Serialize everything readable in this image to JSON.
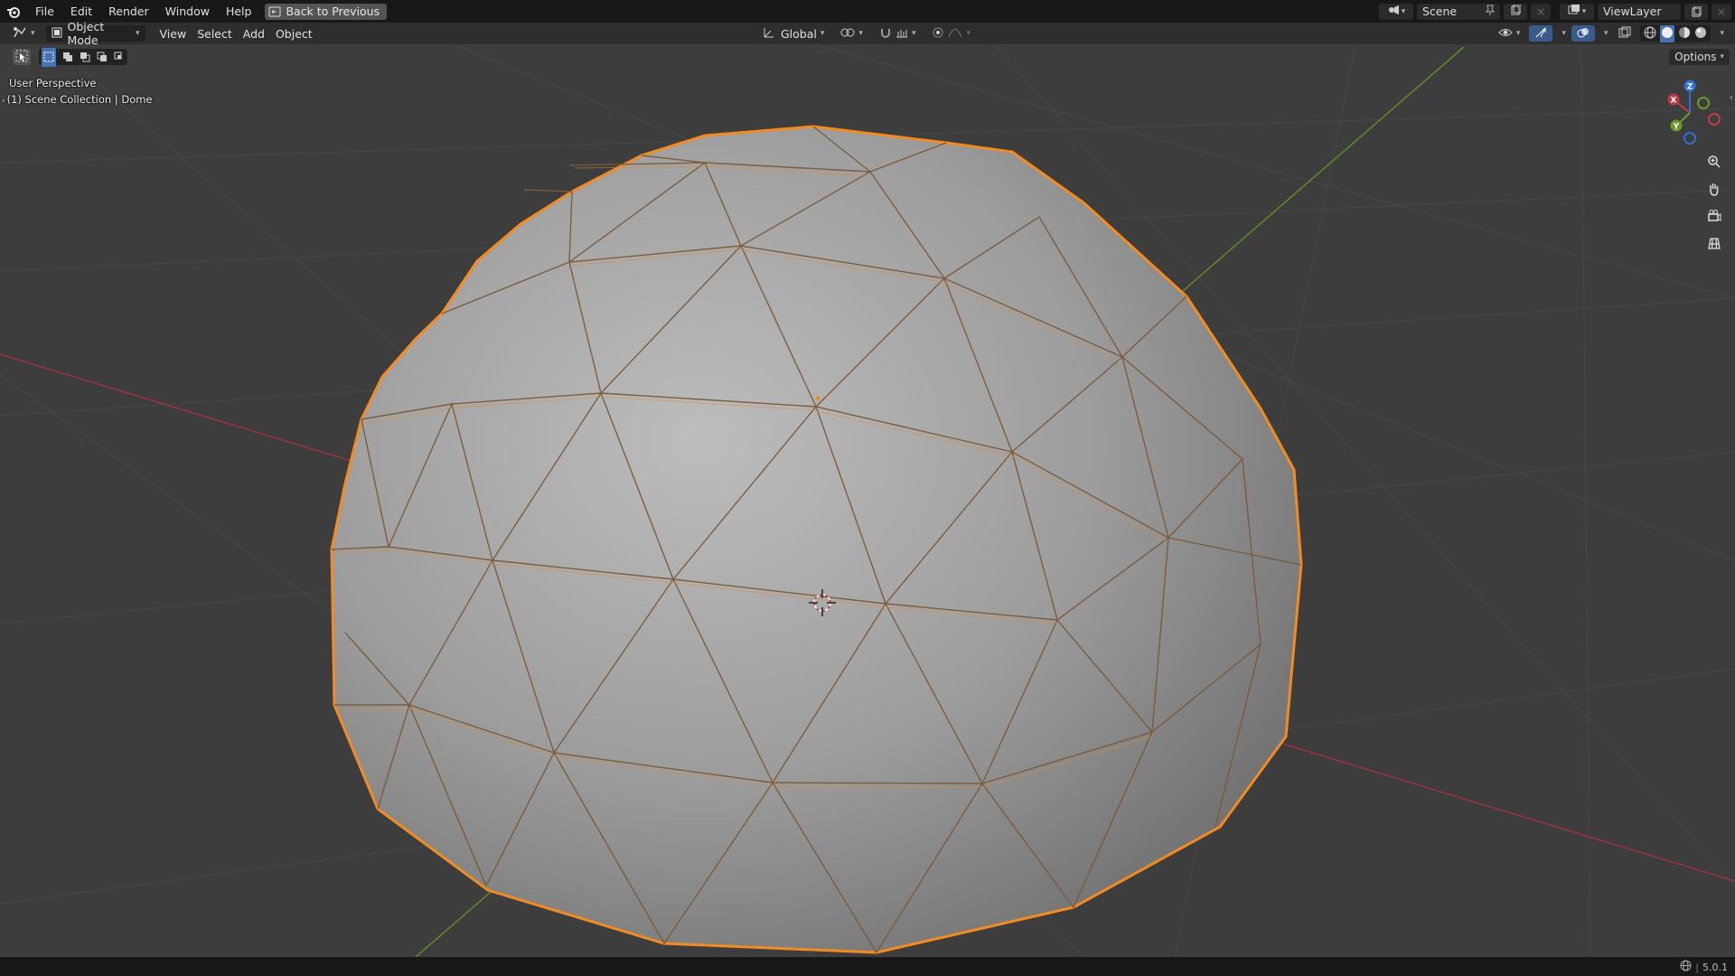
{
  "menus": [
    "File",
    "Edit",
    "Render",
    "Window",
    "Help"
  ],
  "back_button": "Back to Previous",
  "scene": {
    "label": "Scene"
  },
  "view_layer": {
    "label": "ViewLayer"
  },
  "header": {
    "mode": "Object Mode",
    "menus": [
      "View",
      "Select",
      "Add",
      "Object"
    ],
    "transform_orientation": "Global",
    "options": "Options"
  },
  "overlay": {
    "perspective": "User Perspective",
    "collection": "(1) Scene Collection | Dome"
  },
  "gizmo": {
    "x": "X",
    "y": "Y",
    "z": "Z"
  },
  "status": {
    "version": "5.0.1"
  },
  "icons": [
    "blender-logo-icon",
    "back-icon",
    "editor-type-icon",
    "object-mode-icon",
    "transform-orientation-icon",
    "pivot-icon",
    "snap-icon",
    "proportional-edit-icon",
    "scene-icon",
    "pin-icon",
    "new-scene-icon",
    "view-layer-icon",
    "selectability-icon",
    "gizmo-icon",
    "overlay-icon",
    "xray-icon",
    "wireframe-shading-icon",
    "solid-shading-icon",
    "material-shading-icon",
    "rendered-shading-icon",
    "zoom-icon",
    "pan-icon",
    "camera-view-icon",
    "ortho-grid-icon",
    "select-box-icon",
    "globe-icon"
  ],
  "colors": {
    "selection": "#f28b22",
    "viewport_bg": "#3d3d3d",
    "x_axis": "#c0394b",
    "y_axis": "#6a9a2a"
  }
}
